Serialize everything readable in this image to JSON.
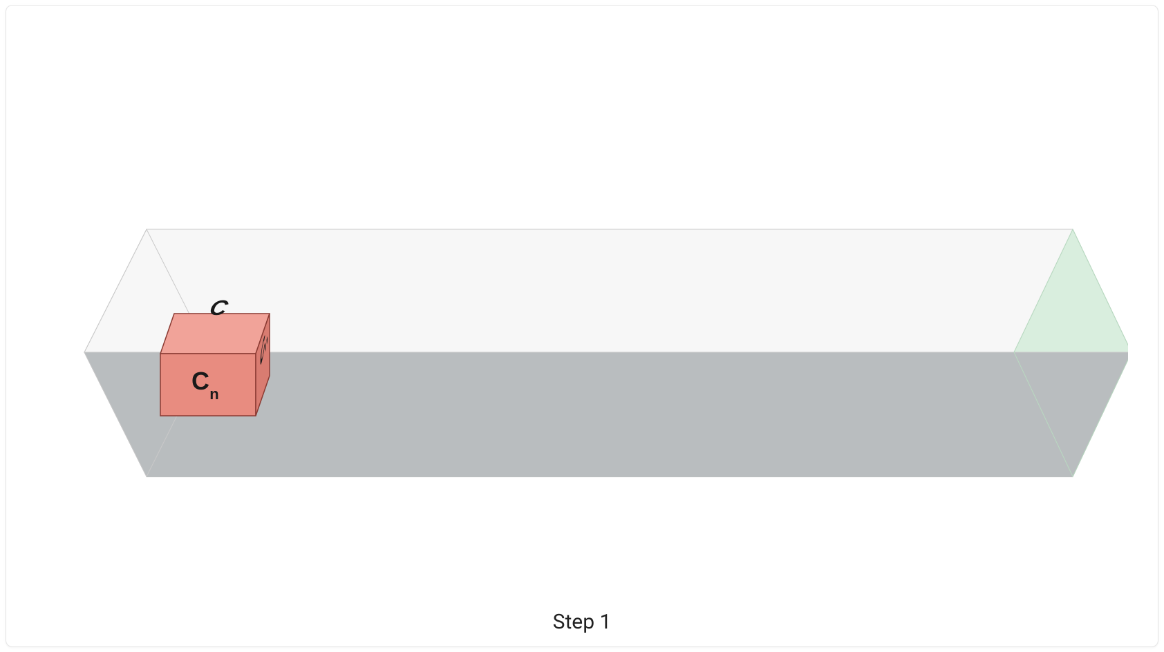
{
  "caption": "Step 1",
  "cube": {
    "faces": {
      "top": "C",
      "front_main": "C",
      "front_sub": "n",
      "right_main": "C",
      "right_sub": "n"
    },
    "colors": {
      "top": "#f1a399",
      "front": "#e88c80",
      "right": "#d97c71",
      "edge": "#8a3a32"
    }
  },
  "corridor": {
    "floor": "#b9bdbf",
    "floor_dark": "#a9adaf",
    "wall": "#f3f3f3",
    "wall_light": "#fbfbfb",
    "edge": "#c9c9c9",
    "end_face": "#d4ecd9"
  }
}
